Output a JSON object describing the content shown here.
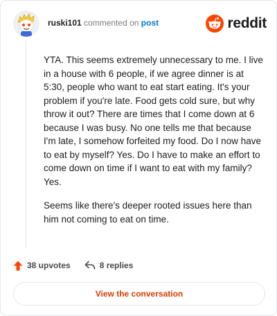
{
  "header": {
    "username": "ruski101",
    "action_text": "commented on",
    "link_text": "post",
    "brand_name": "reddit",
    "brand_color": "#ff4500"
  },
  "comment": {
    "paragraphs": [
      "YTA. This seems extremely unnecessary to me. I live in a house with 6 people, if we agree dinner is at 5:30, people who want to eat start eating. It's your problem if you're late. Food gets cold sure, but why throw it out? There are times that I come down at 6 because I was busy. No one tells me that because I'm late, I somehow forfeited my food. Do I now have to eat by myself? Yes. Do I have to make an effort to come down on time if I want to eat with my family? Yes.",
      "Seems like there's deeper rooted issues here than him not coming to eat on time."
    ]
  },
  "stats": {
    "upvotes": "38 upvotes",
    "replies": "8 replies",
    "upvote_color": "#ff4500"
  },
  "cta": {
    "label": "View the conversation",
    "color": "#d93a00"
  },
  "icons": {
    "avatar": "snoo-avatar",
    "brand": "reddit-logo-icon",
    "upvote": "upvote-arrow-icon",
    "reply": "reply-arrow-icon"
  }
}
